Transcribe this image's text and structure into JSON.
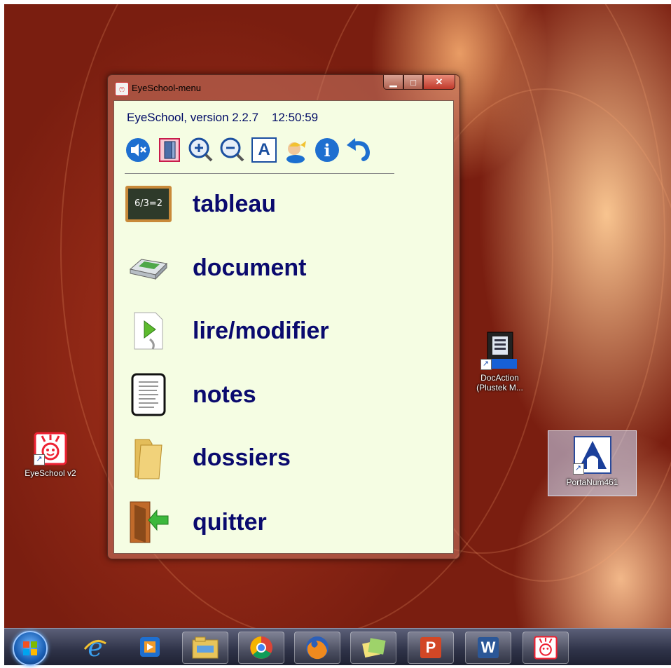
{
  "window": {
    "title": "EyeSchool-menu",
    "version_line": "EyeSchool, version 2.2.7    12:50:59",
    "caption_min": "▁",
    "caption_max": "□",
    "caption_close": "✕"
  },
  "toolbar": {
    "items": [
      {
        "icon": "mute-icon"
      },
      {
        "icon": "window-mode-icon"
      },
      {
        "icon": "zoom-in-icon"
      },
      {
        "icon": "zoom-out-icon"
      },
      {
        "icon": "font-icon",
        "glyph": "A"
      },
      {
        "icon": "user-icon"
      },
      {
        "icon": "info-icon",
        "glyph": "i"
      },
      {
        "icon": "undo-icon"
      }
    ]
  },
  "menu": {
    "items": [
      {
        "label": "tableau",
        "icon": "blackboard-icon",
        "board_text": "6/3=2"
      },
      {
        "label": "document",
        "icon": "scanner-icon"
      },
      {
        "label": "lire/modifier",
        "icon": "play-document-icon"
      },
      {
        "label": "notes",
        "icon": "notepad-icon"
      },
      {
        "label": "dossiers",
        "icon": "folder-icon"
      },
      {
        "label": "quitter",
        "icon": "exit-door-icon"
      }
    ]
  },
  "desktop": {
    "icons": [
      {
        "label": "EyeSchool v2"
      },
      {
        "label": "DocAction (Plustek M..."
      },
      {
        "label": "PortaNum461"
      }
    ]
  },
  "taskbar": {
    "items": [
      {
        "name": "start-button"
      },
      {
        "name": "internet-explorer"
      },
      {
        "name": "media-player"
      },
      {
        "name": "file-explorer"
      },
      {
        "name": "chrome"
      },
      {
        "name": "firefox"
      },
      {
        "name": "sticky-notes"
      },
      {
        "name": "powerpoint",
        "glyph": "P"
      },
      {
        "name": "word",
        "glyph": "W"
      },
      {
        "name": "eyeschool"
      }
    ]
  },
  "colors": {
    "client_bg": "#f5fde3",
    "menu_text": "#0a0a6e",
    "version_text": "#000b66"
  }
}
